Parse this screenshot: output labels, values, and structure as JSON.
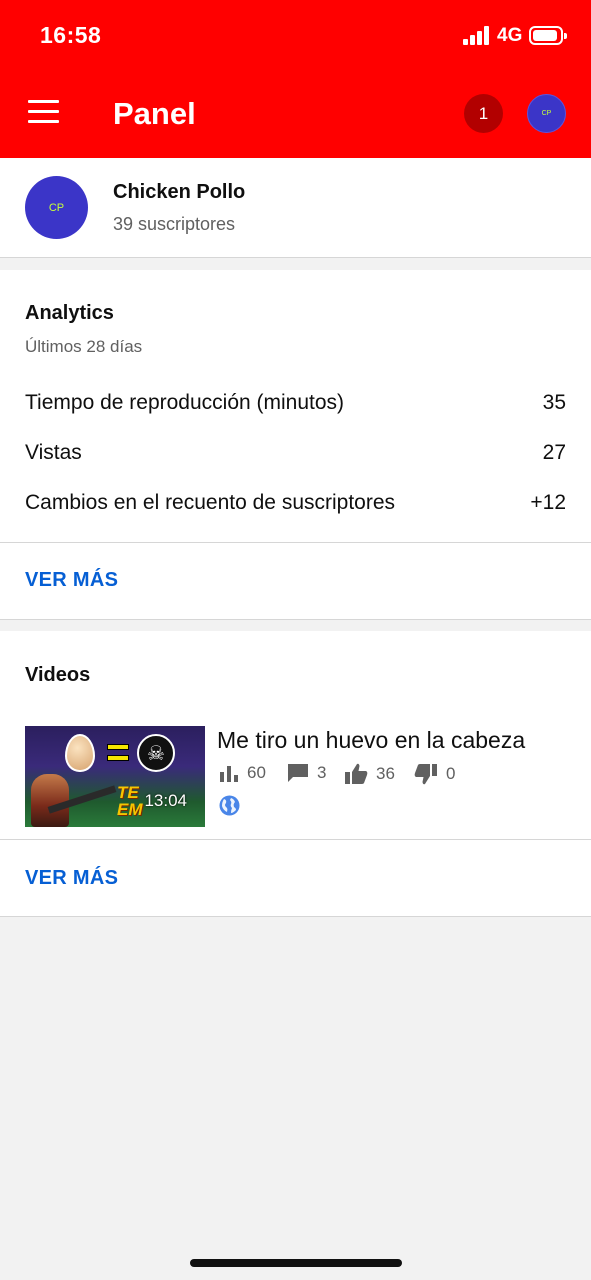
{
  "status_bar": {
    "time": "16:58",
    "network": "4G"
  },
  "header": {
    "title": "Panel",
    "notification_count": "1",
    "avatar_initials": "CP"
  },
  "channel": {
    "name": "Chicken Pollo",
    "subscribers": "39 suscriptores",
    "avatar_initials": "CP"
  },
  "analytics": {
    "title": "Analytics",
    "period": "Últimos 28 días",
    "metrics": [
      {
        "label": "Tiempo de reproducción (minutos)",
        "value": "35"
      },
      {
        "label": "Vistas",
        "value": "27"
      },
      {
        "label": "Cambios en el recuento de suscriptores",
        "value": "+12"
      }
    ],
    "more_label": "VER MÁS"
  },
  "videos": {
    "title": "Videos",
    "items": [
      {
        "title": "Me tiro un huevo en la cabeza",
        "duration": "13:04",
        "views": "60",
        "comments": "3",
        "likes": "36",
        "dislikes": "0",
        "visibility_icon": "globe-icon"
      }
    ],
    "more_label": "VER MÁS"
  },
  "colors": {
    "header": "#ff0000",
    "link": "#065fd4",
    "avatar": "#3b35c8"
  }
}
